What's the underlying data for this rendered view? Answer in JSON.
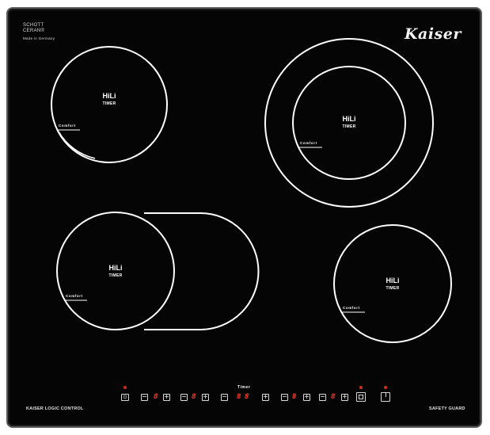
{
  "brand": {
    "schott_line1": "SCHOTT",
    "schott_line2": "CERAN®",
    "made_in": "Made in Germany",
    "logo": "Kaiser"
  },
  "zones": [
    {
      "title": "HiLi",
      "sub": "TIMER",
      "comfort": "Comfort"
    },
    {
      "title": "HiLi",
      "sub": "TIMER",
      "comfort": "Comfort"
    },
    {
      "title": "HiLi",
      "sub": "TIMER",
      "comfort": "Comfort"
    },
    {
      "title": "HiLi",
      "sub": "TIMER",
      "comfort": "Comfort"
    }
  ],
  "controls": {
    "timer_label": "Timer",
    "power_icon": "power-icon",
    "minus_glyph": "−",
    "plus_glyph": "+",
    "displays": [
      "8",
      "8",
      "8",
      "8",
      "8",
      "8"
    ],
    "indicator_color": "#d42a1a",
    "display_color": "#ff3a1a"
  },
  "footer": {
    "left": "KAISER LOGIC CONTROL",
    "right": "SAFETY GUARD"
  }
}
